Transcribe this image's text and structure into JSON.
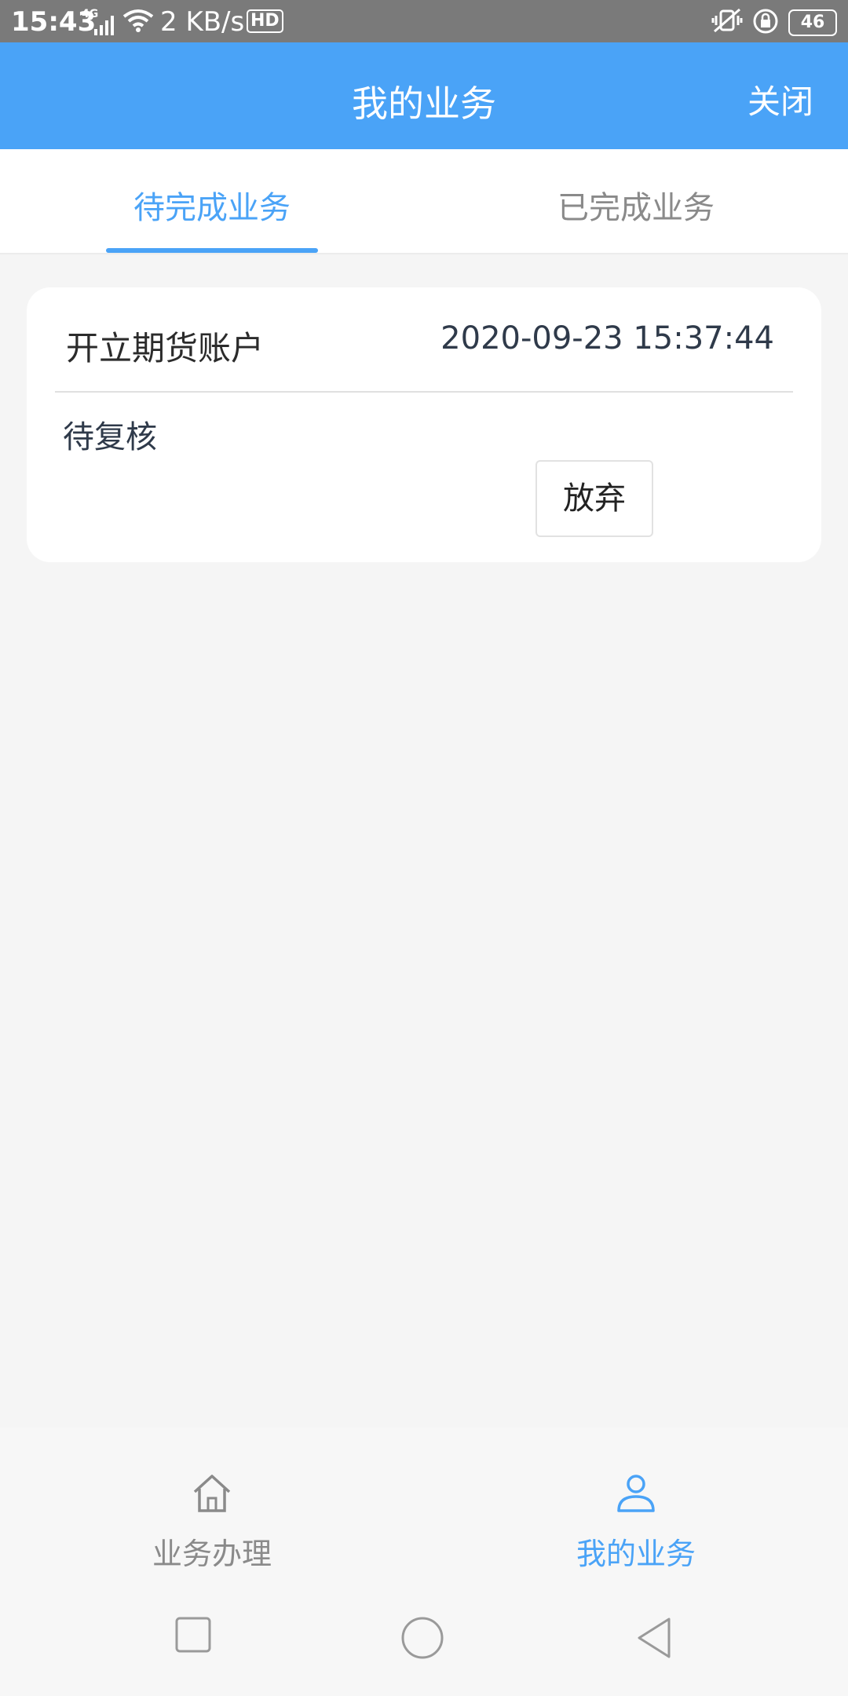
{
  "status_bar": {
    "time": "15:43",
    "network": "4G",
    "speed": "2 KB/s",
    "hd": "HD",
    "battery": "46",
    "icons": [
      "signal-icon",
      "wifi-icon",
      "hd-icon",
      "vibrate-icon",
      "rotation-lock-icon",
      "battery-icon"
    ]
  },
  "header": {
    "title": "我的业务",
    "close_label": "关闭"
  },
  "tabs": [
    {
      "label": "待完成业务",
      "active": true
    },
    {
      "label": "已完成业务",
      "active": false
    }
  ],
  "business_item": {
    "name": "开立期货账户",
    "time": "2020-09-23 15:37:44",
    "status": "待复核",
    "abandon_label": "放弃"
  },
  "bottom_nav": [
    {
      "label": "业务办理",
      "icon": "home-icon",
      "active": false
    },
    {
      "label": "我的业务",
      "icon": "user-icon",
      "active": true
    }
  ],
  "colors": {
    "accent": "#4aa3f7",
    "inactive": "#8a8a8a",
    "background": "#f5f5f5"
  }
}
